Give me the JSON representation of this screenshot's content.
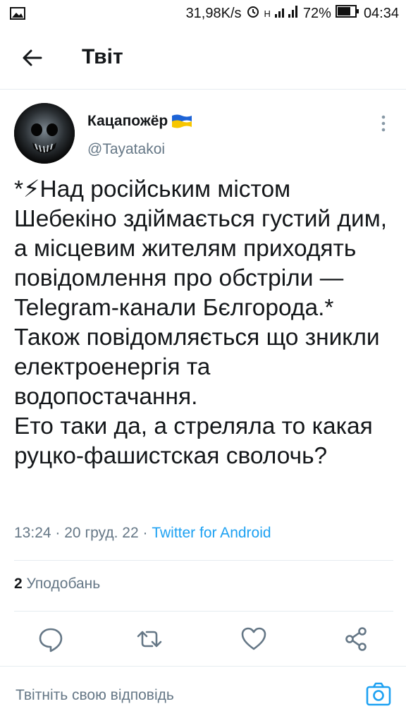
{
  "status_bar": {
    "net_speed": "31,98K/s",
    "network": "H",
    "battery": "72%",
    "time": "04:34"
  },
  "header": {
    "title": "Твіт"
  },
  "author": {
    "name": "Кацапожёр",
    "handle": "@Tayatakoi"
  },
  "tweet": {
    "text": "*⚡Над російським містом Шебекіно здіймається густий дим, а місцевим жителям приходять повідомлення про обстріли — Telegram-канали Бєлгорода.*\nТакож повідомляється що зникли електроенергія та водопостачання.\nЕто таки да, а стреляла то какая руцко-фашистская сволочь?",
    "time": "13:24",
    "date": "20 груд. 22",
    "separator": "·",
    "source": "Twitter for Android"
  },
  "stats": {
    "likes_count": "2",
    "likes_label": "Уподобань"
  },
  "reply": {
    "placeholder": "Твітніть свою відповідь"
  },
  "colors": {
    "accent": "#1da1f2",
    "secondary_text": "#657786",
    "divider": "#e6ecf0",
    "icon": "#657786"
  },
  "icons": [
    "image-icon",
    "alarm-icon",
    "signal-icon",
    "battery-icon",
    "back-arrow-icon",
    "more-vertical-icon",
    "reply-icon",
    "retweet-icon",
    "like-icon",
    "share-icon",
    "camera-icon"
  ]
}
